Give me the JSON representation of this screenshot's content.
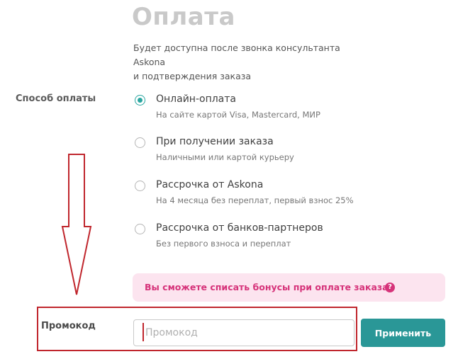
{
  "payment": {
    "title": "Оплата",
    "subtitle_line1": "Будет доступна после звонка консультанта Askona",
    "subtitle_line2": "и подтверждения заказа",
    "method_label": "Способ оплаты",
    "options": [
      {
        "label": "Онлайн-оплата",
        "sub": "На сайте картой Visa, Mastercard, МИР",
        "checked": true
      },
      {
        "label": "При получении заказа",
        "sub": "Наличными или картой курьеру",
        "checked": false
      },
      {
        "label": "Рассрочка от Askona",
        "sub": "На 4 месяца без переплат, первый взнос 25%",
        "checked": false
      },
      {
        "label": "Рассрочка от банков-партнеров",
        "sub": "Без первого взноса и переплат",
        "checked": false
      }
    ],
    "bonus_text": "Вы сможете списать бонусы при оплате заказа",
    "bonus_help_icon": "?"
  },
  "promo": {
    "label": "Промокод",
    "placeholder": "Промокод",
    "value": "",
    "apply_label": "Применить"
  },
  "colors": {
    "accent": "#2a9797",
    "radio_checked": "#2aa6a0",
    "bonus_bg": "#fce4ef",
    "bonus_text": "#d6337a",
    "annotation_red": "#c0262d"
  },
  "icons": {
    "annotation_arrow": "arrow-down-outline-icon",
    "help": "question-circle-icon"
  }
}
